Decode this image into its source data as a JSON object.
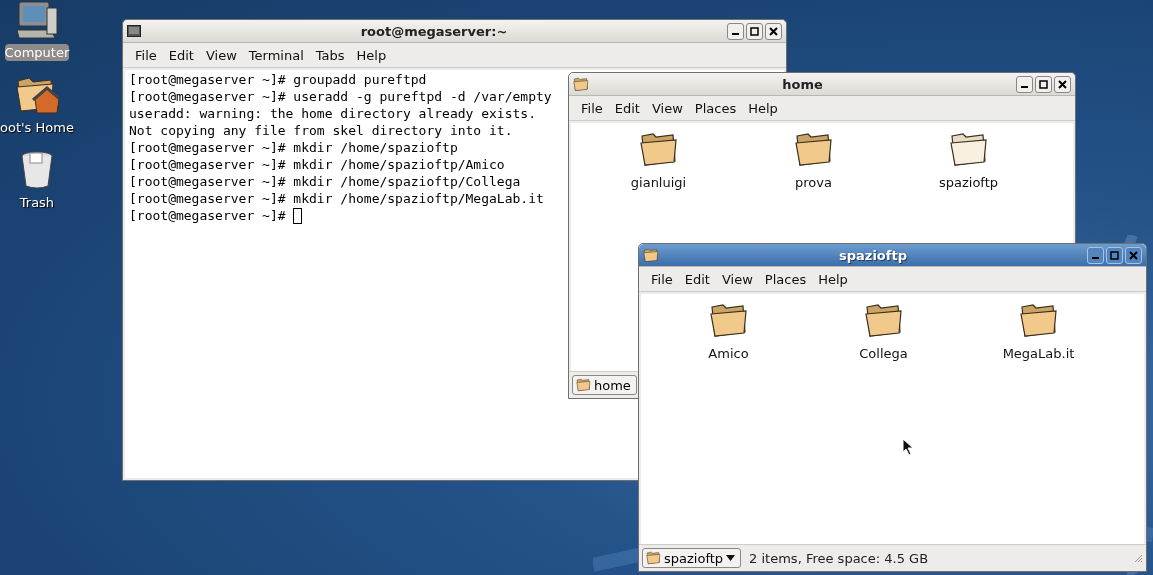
{
  "desktop": {
    "icons": [
      {
        "kind": "computer",
        "label": "Computer",
        "selected": true
      },
      {
        "kind": "home",
        "label": "oot's Home",
        "selected": false
      },
      {
        "kind": "trash",
        "label": "Trash",
        "selected": false
      }
    ]
  },
  "windows": [
    {
      "kind": "terminal",
      "title": "root@megaserver:~",
      "active": false,
      "menu": [
        "File",
        "Edit",
        "View",
        "Terminal",
        "Tabs",
        "Help"
      ],
      "lines": [
        "[root@megaserver ~]# groupadd pureftpd",
        "[root@megaserver ~]# useradd -g pureftpd -d /var/empty",
        "useradd: warning: the home directory already exists.",
        "Not copying any file from skel directory into it.",
        "[root@megaserver ~]# mkdir /home/spazioftp",
        "[root@megaserver ~]# mkdir /home/spazioftp/Amico",
        "[root@megaserver ~]# mkdir /home/spazioftp/Collega",
        "[root@megaserver ~]# mkdir /home/spazioftp/MegaLab.it",
        "[root@megaserver ~]# "
      ]
    },
    {
      "kind": "files",
      "title": "home",
      "active": false,
      "menu": [
        "File",
        "Edit",
        "View",
        "Places",
        "Help"
      ],
      "items": [
        {
          "label": "gianluigi",
          "open": false
        },
        {
          "label": "prova",
          "open": false
        },
        {
          "label": "spazioftp",
          "open": true
        }
      ],
      "location": "home"
    },
    {
      "kind": "files",
      "title": "spazioftp",
      "active": true,
      "menu": [
        "File",
        "Edit",
        "View",
        "Places",
        "Help"
      ],
      "items": [
        {
          "label": "Amico",
          "open": false
        },
        {
          "label": "Collega",
          "open": false
        },
        {
          "label": "MegaLab.it",
          "open": false
        }
      ],
      "location": "spazioftp",
      "status": "2 items, Free space: 4.5 GB"
    }
  ]
}
